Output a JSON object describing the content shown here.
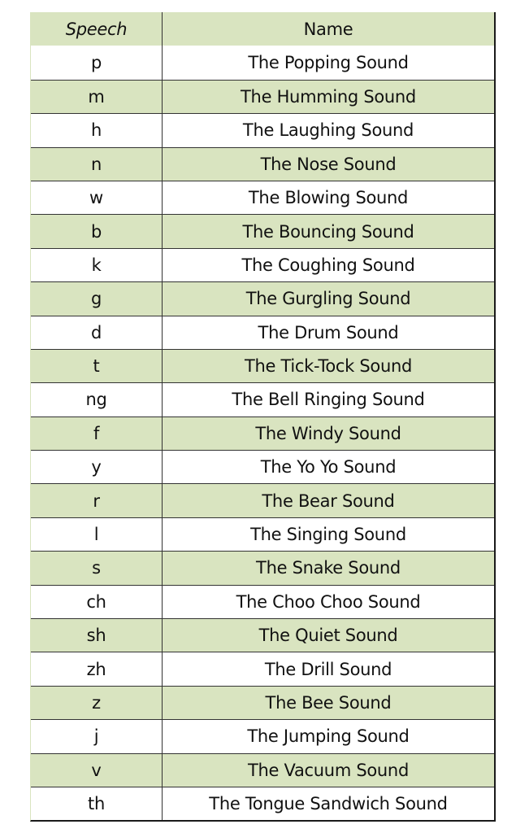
{
  "header": {
    "speech": "Speech",
    "name": "Name"
  },
  "colors": {
    "stripe": "#d9e4c0",
    "border": "#1a1a1a"
  },
  "rows": [
    {
      "speech": "p",
      "name": "The Popping Sound"
    },
    {
      "speech": "m",
      "name": "The Humming Sound"
    },
    {
      "speech": "h",
      "name": "The Laughing Sound"
    },
    {
      "speech": "n",
      "name": "The Nose Sound"
    },
    {
      "speech": "w",
      "name": "The Blowing Sound"
    },
    {
      "speech": "b",
      "name": "The Bouncing Sound"
    },
    {
      "speech": "k",
      "name": "The Coughing Sound"
    },
    {
      "speech": "g",
      "name": "The Gurgling Sound"
    },
    {
      "speech": "d",
      "name": "The Drum Sound"
    },
    {
      "speech": "t",
      "name": "The Tick-Tock Sound"
    },
    {
      "speech": "ng",
      "name": "The Bell Ringing Sound"
    },
    {
      "speech": "f",
      "name": "The Windy Sound"
    },
    {
      "speech": "y",
      "name": "The Yo Yo Sound"
    },
    {
      "speech": "r",
      "name": "The Bear Sound"
    },
    {
      "speech": "l",
      "name": "The Singing Sound"
    },
    {
      "speech": "s",
      "name": "The Snake Sound"
    },
    {
      "speech": "ch",
      "name": "The Choo Choo Sound"
    },
    {
      "speech": "sh",
      "name": "The Quiet Sound"
    },
    {
      "speech": "zh",
      "name": "The Drill Sound"
    },
    {
      "speech": "z",
      "name": "The Bee Sound"
    },
    {
      "speech": "j",
      "name": "The Jumping Sound"
    },
    {
      "speech": "v",
      "name": "The Vacuum Sound"
    },
    {
      "speech": "th",
      "name": "The Tongue Sandwich Sound"
    }
  ]
}
